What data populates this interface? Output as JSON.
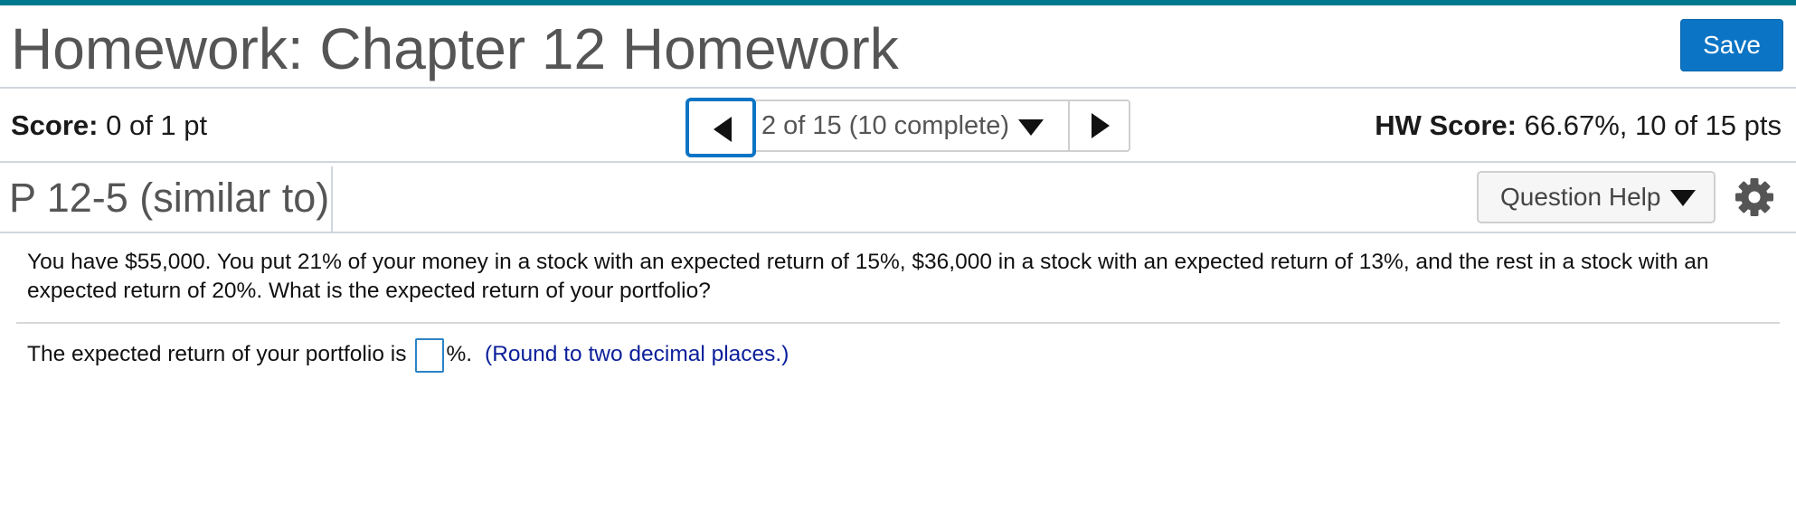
{
  "header": {
    "title": "Homework: Chapter 12 Homework",
    "save_label": "Save"
  },
  "score_bar": {
    "score_label": "Score:",
    "score_value": "0 of 1 pt",
    "nav": {
      "position_label": "2 of 15 (10 complete)"
    },
    "hw_score_label": "HW Score:",
    "hw_score_value": "66.67%, 10 of 15 pts"
  },
  "question": {
    "id_label": "P 12-5 (similar to)",
    "help_label": "Question Help",
    "text": "You have $55,000. You put 21% of your money in a stock with an expected return of 15%, $36,000 in a stock with an expected return of 13%, and the rest in a stock with an expected return of 20%. What is the expected return of your portfolio?",
    "answer_prefix": "The expected return of your portfolio is",
    "answer_value": "",
    "answer_suffix": "%.",
    "hint": "(Round to two decimal places.)"
  },
  "icons": {
    "prev": "caret-left-icon",
    "next": "caret-right-icon",
    "dropdown": "caret-down-icon",
    "settings": "gear-icon"
  },
  "colors": {
    "accent_stripe": "#00798f",
    "save_button": "#0b74c4",
    "hint_text": "#0b1f9a"
  }
}
